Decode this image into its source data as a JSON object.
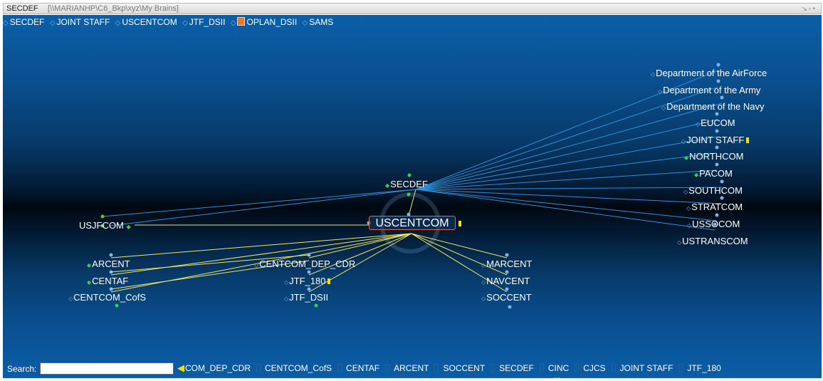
{
  "window": {
    "title": "SECDEF",
    "path": "[\\\\MARIANHP\\C6_Bkp\\xyz\\My Brains]"
  },
  "plex_bar": [
    {
      "label": "SECDEF",
      "has_icon": false
    },
    {
      "label": "JOINT STAFF",
      "has_icon": false
    },
    {
      "label": "USCENTCOM",
      "has_icon": false
    },
    {
      "label": "JTF_DSII",
      "has_icon": false
    },
    {
      "label": "OPLAN_DSII",
      "has_icon": true
    },
    {
      "label": "SAMS",
      "has_icon": false
    }
  ],
  "active_thought": {
    "label": "USCENTCOM",
    "has_note": true
  },
  "parent": {
    "label": "SECDEF"
  },
  "jumps": [
    {
      "label": "USJFCOM"
    }
  ],
  "children": [
    {
      "label": "ARCENT"
    },
    {
      "label": "CENTAF"
    },
    {
      "label": "CENTCOM_CofS"
    },
    {
      "label": "CENTCOM_DEP_CDR"
    },
    {
      "label": "JTF_180",
      "has_note": true
    },
    {
      "label": "JTF_DSII"
    },
    {
      "label": "MARCENT"
    },
    {
      "label": "NAVCENT"
    },
    {
      "label": "SOCCENT"
    }
  ],
  "siblings": [
    {
      "label": "Department of the AirForce"
    },
    {
      "label": "Department of the Army"
    },
    {
      "label": "Department of the Navy"
    },
    {
      "label": "EUCOM"
    },
    {
      "label": "JOINT STAFF",
      "has_note": true
    },
    {
      "label": "NORTHCOM"
    },
    {
      "label": "PACOM"
    },
    {
      "label": "SOUTHCOM"
    },
    {
      "label": "STRATCOM"
    },
    {
      "label": "USSOCOM"
    },
    {
      "label": "USTRANSCOM"
    }
  ],
  "search": {
    "label": "Search:",
    "value": ""
  },
  "recent_thoughts": [
    "COM_DEP_CDR",
    "CENTCOM_CofS",
    "CENTAF",
    "ARCENT",
    "SOCCENT",
    "SECDEF",
    "CINC",
    "CJCS",
    "JOINT STAFF",
    "JTF_180"
  ],
  "colors": {
    "background_top": "#0a5fa8",
    "background_mid": "#000811",
    "link_line": "#2f8fd6",
    "child_line": "#f0e860",
    "active_border": "#e06a2a",
    "note_flag": "#f2e000",
    "dot_green": "#35d24a",
    "dot_blue": "#7fb3e6"
  }
}
